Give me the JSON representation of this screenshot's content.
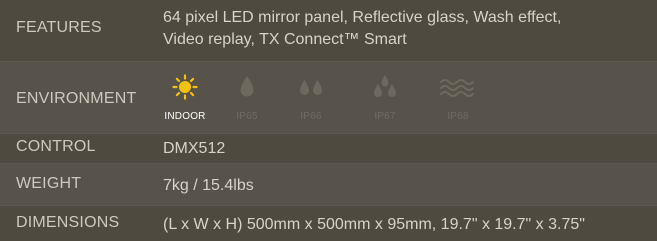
{
  "specs": {
    "features": {
      "label": "FEATURES",
      "value_line1": "64 pixel LED mirror panel, Reflective glass, Wash effect,",
      "value_line2": "Video replay, TX Connect™ Smart"
    },
    "environment": {
      "label": "ENVIRONMENT",
      "items": [
        {
          "caption": "INDOOR",
          "icon": "sun-icon",
          "active": true
        },
        {
          "caption": "IP65",
          "icon": "single-drop-icon",
          "active": false
        },
        {
          "caption": "IP66",
          "icon": "double-drop-icon",
          "active": false
        },
        {
          "caption": "IP67",
          "icon": "triple-drop-icon",
          "active": false
        },
        {
          "caption": "IP68",
          "icon": "waves-icon",
          "active": false
        }
      ]
    },
    "control": {
      "label": "CONTROL",
      "value": "DMX512"
    },
    "weight": {
      "label": "WEIGHT",
      "value": "7kg / 15.4lbs"
    },
    "dimensions": {
      "label": "DIMENSIONS",
      "value": "(L x W x H) 500mm x 500mm x 95mm, 19.7\" x 19.7\" x 3.75\""
    }
  },
  "colors": {
    "background": "#4e4a40",
    "alt_row": "#57534a",
    "active_icon": "#f5c20a",
    "inactive_icon": "#6e695e"
  }
}
